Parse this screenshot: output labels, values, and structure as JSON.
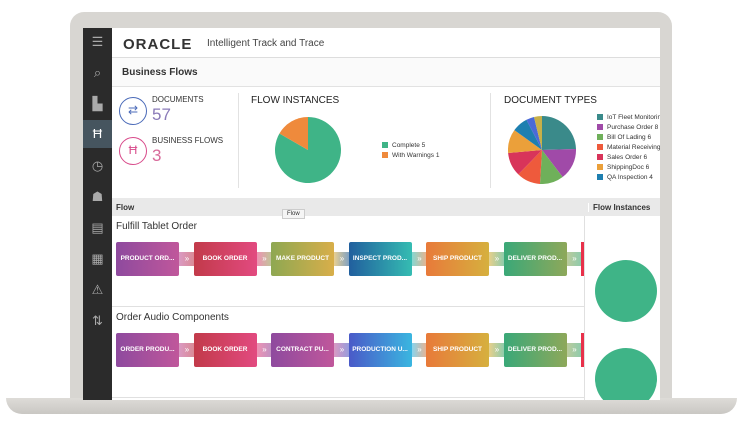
{
  "header": {
    "logo": "ORACLE",
    "app_name": "Intelligent Track and Trace"
  },
  "page_title": "Business Flows",
  "summary": {
    "documents_label": "DOCUMENTS",
    "documents_count": "57",
    "flows_label": "BUSINESS FLOWS",
    "flows_count": "3"
  },
  "flow_instances": {
    "title": "FLOW INSTANCES",
    "legend": [
      {
        "label": "Complete 5",
        "color": "#3fb487",
        "value": 5
      },
      {
        "label": "With Warnings 1",
        "color": "#ef8a3c",
        "value": 1
      }
    ]
  },
  "document_types": {
    "title": "DOCUMENT TYPES",
    "legend": [
      {
        "label": "IoT Fleet Monitoring",
        "color": "#3a8a8a",
        "value": 13
      },
      {
        "label": "Purchase Order 8",
        "color": "#a04aa8",
        "value": 8
      },
      {
        "label": "Bill Of Lading 6",
        "color": "#6fb05a",
        "value": 6
      },
      {
        "label": "Material Receiving",
        "color": "#ee5a3c",
        "value": 6
      },
      {
        "label": "Sales Order 6",
        "color": "#d8345a",
        "value": 6
      },
      {
        "label": "ShippingDoc 6",
        "color": "#eba03a",
        "value": 6
      },
      {
        "label": "QA Inspection 4",
        "color": "#1e7fb0",
        "value": 4
      },
      {
        "label": "",
        "color": "#4a6ad8",
        "value": 2
      },
      {
        "label": "",
        "color": "#c8b048",
        "value": 2
      }
    ]
  },
  "table": {
    "col_flow": "Flow",
    "col_instances": "Flow Instances",
    "tooltip": "Flow"
  },
  "flows": [
    {
      "name": "Fulfill Tablet Order",
      "steps": [
        {
          "label": "PRODUCT ORD...",
          "colors": [
            "#8e4a9e",
            "#c0579b"
          ]
        },
        {
          "label": "BOOK ORDER",
          "colors": [
            "#c23a4a",
            "#e24a80"
          ]
        },
        {
          "label": "MAKE PRODUCT",
          "colors": [
            "#8ea852",
            "#d8ae4a"
          ]
        },
        {
          "label": "INSPECT PROD...",
          "colors": [
            "#215f9e",
            "#35bcb2"
          ]
        },
        {
          "label": "SHIP PRODUCT",
          "colors": [
            "#e87a3a",
            "#d6b03e"
          ]
        },
        {
          "label": "DELIVER PROD...",
          "colors": [
            "#3aa878",
            "#8ea85a"
          ]
        }
      ]
    },
    {
      "name": "Order Audio Components",
      "steps": [
        {
          "label": "ORDER PRODU...",
          "colors": [
            "#8e4a9e",
            "#c0579b"
          ]
        },
        {
          "label": "BOOK ORDER",
          "colors": [
            "#c23a4a",
            "#e24a80"
          ]
        },
        {
          "label": "CONTRACT PU...",
          "colors": [
            "#8e4a9e",
            "#c0579b"
          ]
        },
        {
          "label": "PRODUCTION U...",
          "colors": [
            "#4a5ac8",
            "#3ab6e0"
          ]
        },
        {
          "label": "SHIP PRODUCT",
          "colors": [
            "#e87a3a",
            "#d6b03e"
          ]
        },
        {
          "label": "DELIVER PROD...",
          "colors": [
            "#3aa878",
            "#8ea85a"
          ]
        }
      ]
    }
  ]
}
